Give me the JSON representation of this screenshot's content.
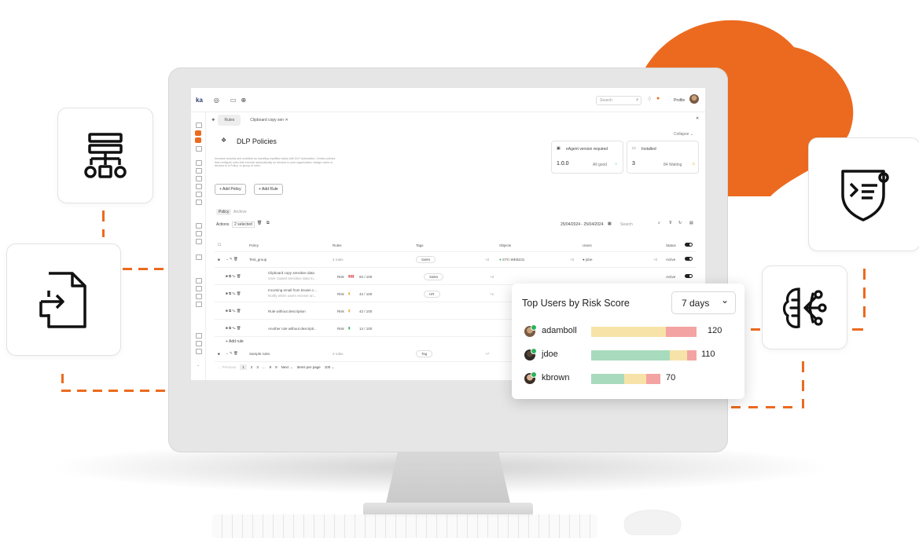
{
  "app": {
    "logo": "ka",
    "search_placeholder": "Search",
    "profile_label": "Profile"
  },
  "tabs": [
    {
      "label": "Rules",
      "active": true
    },
    {
      "label": "Clipboard copy sen",
      "active": false
    }
  ],
  "page": {
    "title": "DLP Policies",
    "description": "Increase security and workflow by handling repetitive tasks with DLP automation. Create policies that configure rules that execute automatically on devices in your organization. Assign users or devices to a Policy, or group of rules.",
    "collapse_label": "Collapse",
    "add_policy_label": "Add Policy",
    "add_rule_label": "Add Rule"
  },
  "stats": {
    "version_title": "eAgent version required",
    "version_value": "1.0.0",
    "version_status": "All good",
    "installed_title": "Installed",
    "installed_value": "3",
    "installed_status": "84 Waiting"
  },
  "subtabs": [
    "Policy",
    "Archive"
  ],
  "actions": {
    "label": "Actions",
    "selected": "2 selected",
    "date_range": "25/04/2024 - 25/04/2024",
    "search": "Search"
  },
  "table": {
    "headers": [
      "Policy",
      "Rules",
      "Tags",
      "Objects",
      "Users",
      "Status"
    ],
    "rows": [
      {
        "name": "Test_group",
        "rules": "4 rules",
        "tag": "Sales",
        "count": "+2",
        "object": "STC-WEB231",
        "objcount": "+2",
        "user": "jdoe",
        "usercount": "+2",
        "status": "Active",
        "risk": ""
      },
      {
        "name": "Clipboard copy sensitive data",
        "sub": "User copied sensitive data to...",
        "rules": "Risk",
        "risk": "92 / 100",
        "tag": "Sales",
        "count": "+2",
        "status": "Active"
      },
      {
        "name": "Incoming email from known c...",
        "sub": "Notify when users receive an...",
        "rules": "Risk",
        "risk": "42 / 100",
        "tag": "HR",
        "count": "+1",
        "status": ""
      },
      {
        "name": "Rule without description",
        "sub": "",
        "rules": "Risk",
        "risk": "42 / 100",
        "tag": "",
        "count": "",
        "status": ""
      },
      {
        "name": "Another rule without descripti...",
        "sub": "",
        "rules": "Risk",
        "risk": "12 / 100",
        "tag": "",
        "count": "",
        "status": ""
      }
    ],
    "add_rule": "Add rule",
    "sample": {
      "name": "Sample rules",
      "rules": "2 rules",
      "tag": "Tag",
      "count": "+7"
    }
  },
  "pagination": {
    "previous": "Previous",
    "pages": [
      "1",
      "2",
      "3",
      "...",
      "8",
      "9"
    ],
    "next": "Next",
    "items_per_page_label": "Items per page",
    "items_per_page": "100"
  },
  "widget": {
    "title": "Top Users by Risk Score",
    "period": "7 days",
    "users": [
      {
        "name": "adamboll",
        "score": "120"
      },
      {
        "name": "jdoe",
        "score": "110"
      },
      {
        "name": "kbrown",
        "score": "70"
      }
    ]
  },
  "colors": {
    "accent": "#ec6a1f",
    "bar_green": "#a8dbbd",
    "bar_yellow": "#f7e3a8",
    "bar_red": "#f4a3a3"
  }
}
